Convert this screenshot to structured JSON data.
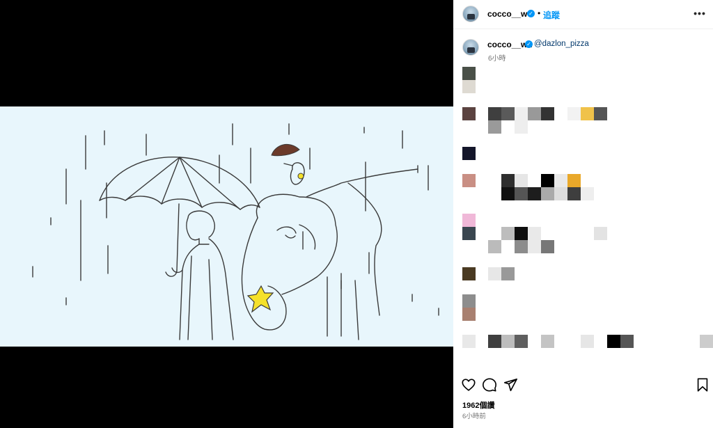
{
  "post": {
    "username": "cocco__wu",
    "follow_label": "追蹤",
    "more_label": "•••"
  },
  "caption": {
    "username": "cocco__wu",
    "mention": "@dazlon_pizza",
    "time_ago": "6小時"
  },
  "stats": {
    "views": "1962個讚",
    "posted_ago": "6小時前"
  },
  "icons": {
    "verified": "verified-badge-icon",
    "like": "heart-icon",
    "comment": "speech-bubble-icon",
    "share": "paper-plane-icon",
    "save": "bookmark-icon",
    "more": "more-options-icon"
  },
  "colors": {
    "accent": "#0095f6",
    "mention": "#00376b",
    "artwork_bg": "#e8f6fc",
    "star": "#f5e12a"
  }
}
